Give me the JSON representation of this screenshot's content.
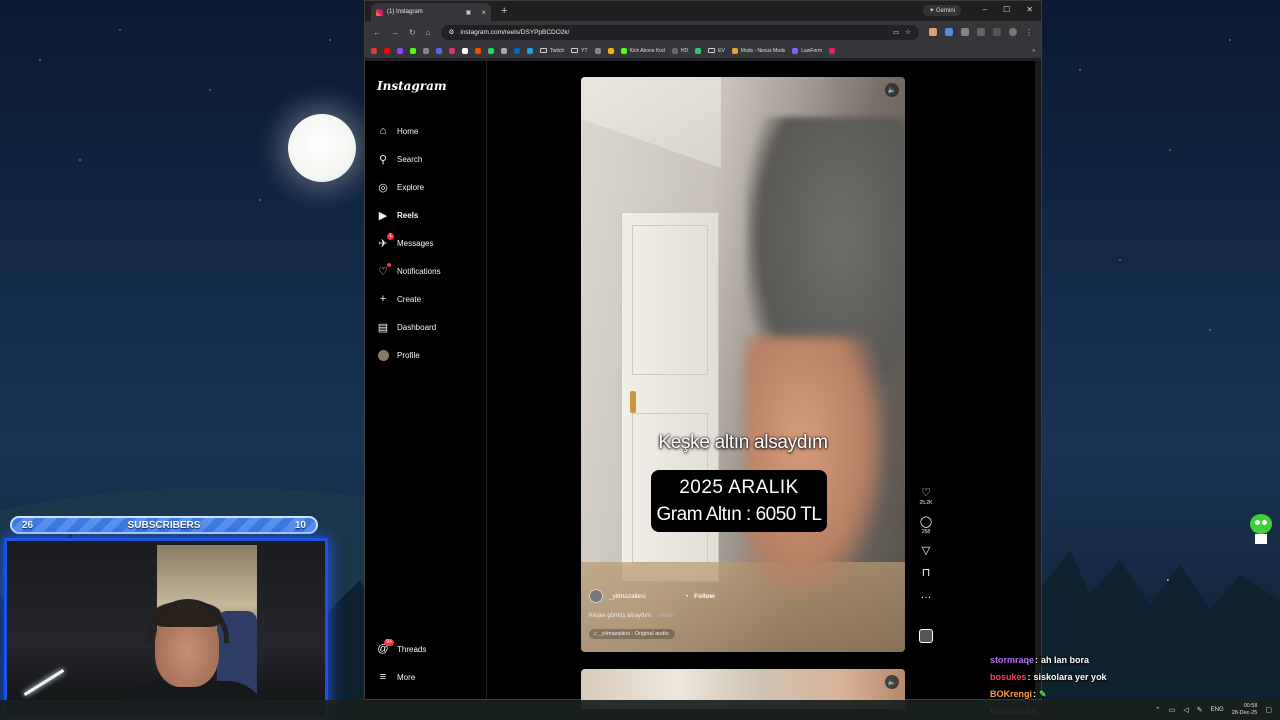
{
  "browser": {
    "tab_title": "(1) Instagram",
    "gemini_label": "Gemini",
    "url": "instagram.com/reels/DSYPpBCDO2k/",
    "bookmarks": [
      "Twitch",
      "YT",
      "Kick Abone Kod",
      "HD",
      "EV",
      "Mods - Nexus Mods",
      "LawForm"
    ]
  },
  "instagram": {
    "logo": "Instagram",
    "nav": [
      {
        "label": "Home",
        "icon": "home-icon"
      },
      {
        "label": "Search",
        "icon": "search-icon"
      },
      {
        "label": "Explore",
        "icon": "explore-icon"
      },
      {
        "label": "Reels",
        "icon": "reels-icon"
      },
      {
        "label": "Messages",
        "icon": "messages-icon",
        "badge": "1"
      },
      {
        "label": "Notifications",
        "icon": "heart-icon"
      },
      {
        "label": "Create",
        "icon": "plus-icon"
      },
      {
        "label": "Dashboard",
        "icon": "dashboard-icon"
      },
      {
        "label": "Profile",
        "icon": "avatar-icon"
      }
    ],
    "nav_bottom": [
      {
        "label": "Threads",
        "icon": "threads-icon",
        "badge": "9+"
      },
      {
        "label": "More",
        "icon": "menu-icon"
      }
    ]
  },
  "reel": {
    "caption_top": "Keşke altın alsaydım",
    "caption_line1": "2025  ARALIK",
    "caption_line2": "Gram Altın : 6050 TL",
    "username": "_yilmazailesi",
    "follow": "Follow",
    "description": "Keşke gümüş alsaydım",
    "more": "... more",
    "audio": "_yilmazailesi · Original audio",
    "likes": "25.2K",
    "comments": "268"
  },
  "stream": {
    "sub_left": "26",
    "sub_label": "SUBSCRIBERS",
    "sub_right": "10",
    "chat": [
      {
        "user": "stormraqe",
        "color": "#b06cf5",
        "message": "ah lan bora"
      },
      {
        "user": "bosukes",
        "color": "#ff3b5c",
        "message": "siskolara yer yok"
      },
      {
        "user": "BOKrengi",
        "color": "#ff9a3c",
        "message": ""
      },
      {
        "user": "thracian34",
        "color": "#ffa940",
        "message": ""
      }
    ]
  },
  "taskbar": {
    "lang": "ENG",
    "time": "00:58",
    "date": "28-Dec-25"
  }
}
